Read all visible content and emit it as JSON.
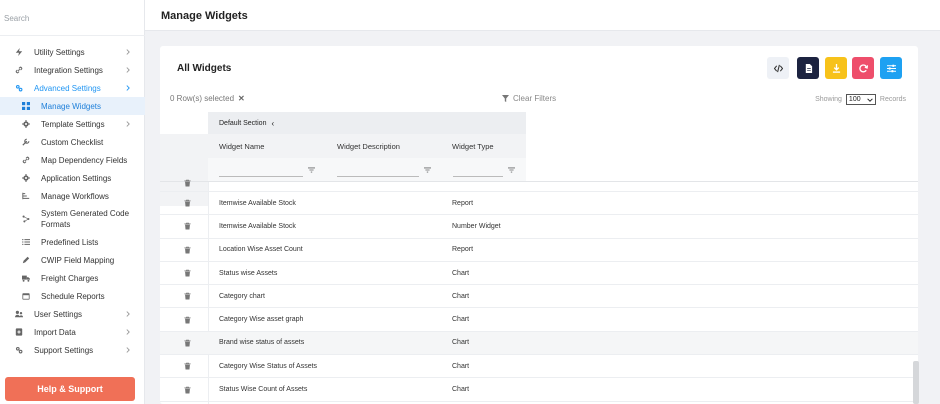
{
  "sidebar": {
    "search_placeholder": "Search",
    "items": [
      {
        "label": "Utility Settings",
        "icon": "bolt-icon",
        "level": "top",
        "chevron": true
      },
      {
        "label": "Integration Settings",
        "icon": "link-icon",
        "level": "top",
        "chevron": true
      },
      {
        "label": "Advanced Settings",
        "icon": "gears-icon",
        "level": "top",
        "chevron": true,
        "active": true
      },
      {
        "label": "Manage Widgets",
        "icon": "grid-icon",
        "level": "sub",
        "selected": true
      },
      {
        "label": "Template Settings",
        "icon": "gear-icon",
        "level": "sub",
        "chevron": true
      },
      {
        "label": "Custom Checklist",
        "icon": "wrench-icon",
        "level": "sub"
      },
      {
        "label": "Map Dependency Fields",
        "icon": "link-icon",
        "level": "sub"
      },
      {
        "label": "Application Settings",
        "icon": "gear-icon",
        "level": "sub"
      },
      {
        "label": "Manage Workflows",
        "icon": "workflow-icon",
        "level": "sub"
      },
      {
        "label": "System Generated Code Formats",
        "icon": "code-format-icon",
        "level": "sub",
        "two_line": true
      },
      {
        "label": "Predefined Lists",
        "icon": "list-icon",
        "level": "sub"
      },
      {
        "label": "CWIP Field Mapping",
        "icon": "pencil-icon",
        "level": "sub"
      },
      {
        "label": "Freight Charges",
        "icon": "truck-icon",
        "level": "sub"
      },
      {
        "label": "Schedule Reports",
        "icon": "calendar-icon",
        "level": "sub"
      },
      {
        "label": "User Settings",
        "icon": "users-icon",
        "level": "top",
        "chevron": true
      },
      {
        "label": "Import Data",
        "icon": "import-icon",
        "level": "top",
        "chevron": true
      },
      {
        "label": "Support Settings",
        "icon": "gears-icon",
        "level": "top",
        "chevron": true
      }
    ],
    "help_label": "Help & Support"
  },
  "header": {
    "title": "Manage Widgets"
  },
  "card": {
    "title": "All Widgets",
    "toolbar": [
      {
        "name": "code-button",
        "icon": "code-icon",
        "color": "#eef1f6"
      },
      {
        "name": "document-button",
        "icon": "document-icon",
        "color": "#1c2340"
      },
      {
        "name": "download-button",
        "icon": "download-icon",
        "color": "#f7c21a"
      },
      {
        "name": "refresh-button",
        "icon": "refresh-icon",
        "color": "#ee4e6b"
      },
      {
        "name": "settings-button",
        "icon": "sliders-icon",
        "color": "#1ea1f2"
      }
    ],
    "rows_selected": "0 Row(s) selected",
    "clear_filters": "Clear Filters",
    "showing_label": "Showing",
    "records_value": "100",
    "records_label": "Records"
  },
  "table": {
    "group_header": "Default Section",
    "columns": [
      "Widget Name",
      "Widget Description",
      "Widget Type"
    ],
    "rows": [
      {
        "name": "Itemwise Available Stock",
        "description": "",
        "type": "Report"
      },
      {
        "name": "Itemwise Available Stock",
        "description": "",
        "type": "Number Widget"
      },
      {
        "name": "Location Wise Asset Count",
        "description": "",
        "type": "Report"
      },
      {
        "name": "Status wise Assets",
        "description": "",
        "type": "Chart"
      },
      {
        "name": "Category chart",
        "description": "",
        "type": "Chart"
      },
      {
        "name": "Category Wise asset graph",
        "description": "",
        "type": "Chart"
      },
      {
        "name": "Brand wise status of assets",
        "description": "",
        "type": "Chart"
      },
      {
        "name": "Category Wise Status of Assets",
        "description": "",
        "type": "Chart"
      },
      {
        "name": "Status Wise Count of Assets",
        "description": "",
        "type": "Chart"
      }
    ]
  },
  "colors": {
    "accent": "#2196f3",
    "help_button": "#f07057"
  }
}
